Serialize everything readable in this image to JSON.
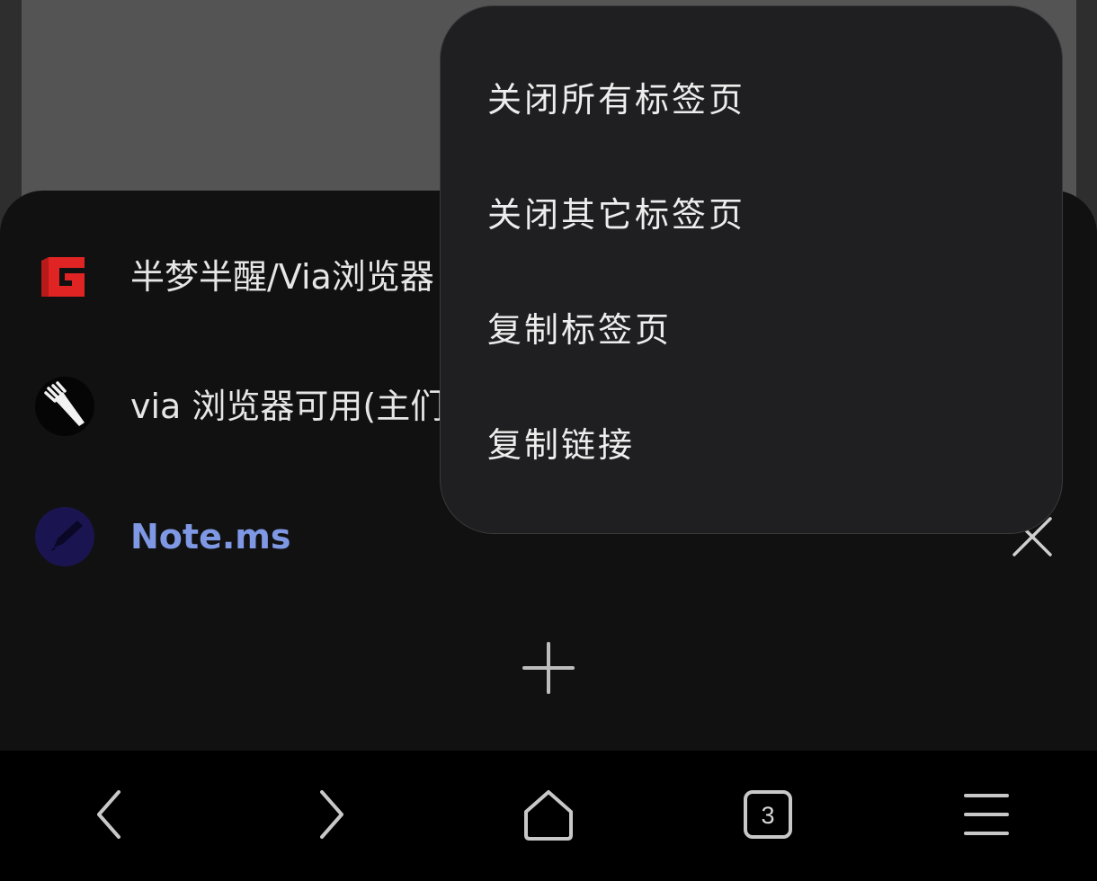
{
  "tabs": [
    {
      "title": "半梦半醒/Via浏览器",
      "favicon": "g-red-logo-icon",
      "active": false
    },
    {
      "title": "via 浏览器可用(主们",
      "favicon": "fork-icon",
      "active": false
    },
    {
      "title": "Note.ms",
      "favicon": "note-pen-icon",
      "active": true
    }
  ],
  "menu": {
    "items": [
      {
        "label": "关闭所有标签页"
      },
      {
        "label": "关闭其它标签页"
      },
      {
        "label": "复制标签页"
      },
      {
        "label": "复制链接"
      }
    ]
  },
  "bottom_nav": {
    "tab_count": "3",
    "buttons": [
      "back-icon",
      "forward-icon",
      "home-icon",
      "tabs-icon",
      "menu-icon"
    ]
  },
  "colors": {
    "active_tab_title": "#7f98e4",
    "g_logo_red": "#e02424",
    "note_circle": "#1a1550",
    "menu_bg": "#1f1f21",
    "sheet_bg": "#111112"
  }
}
